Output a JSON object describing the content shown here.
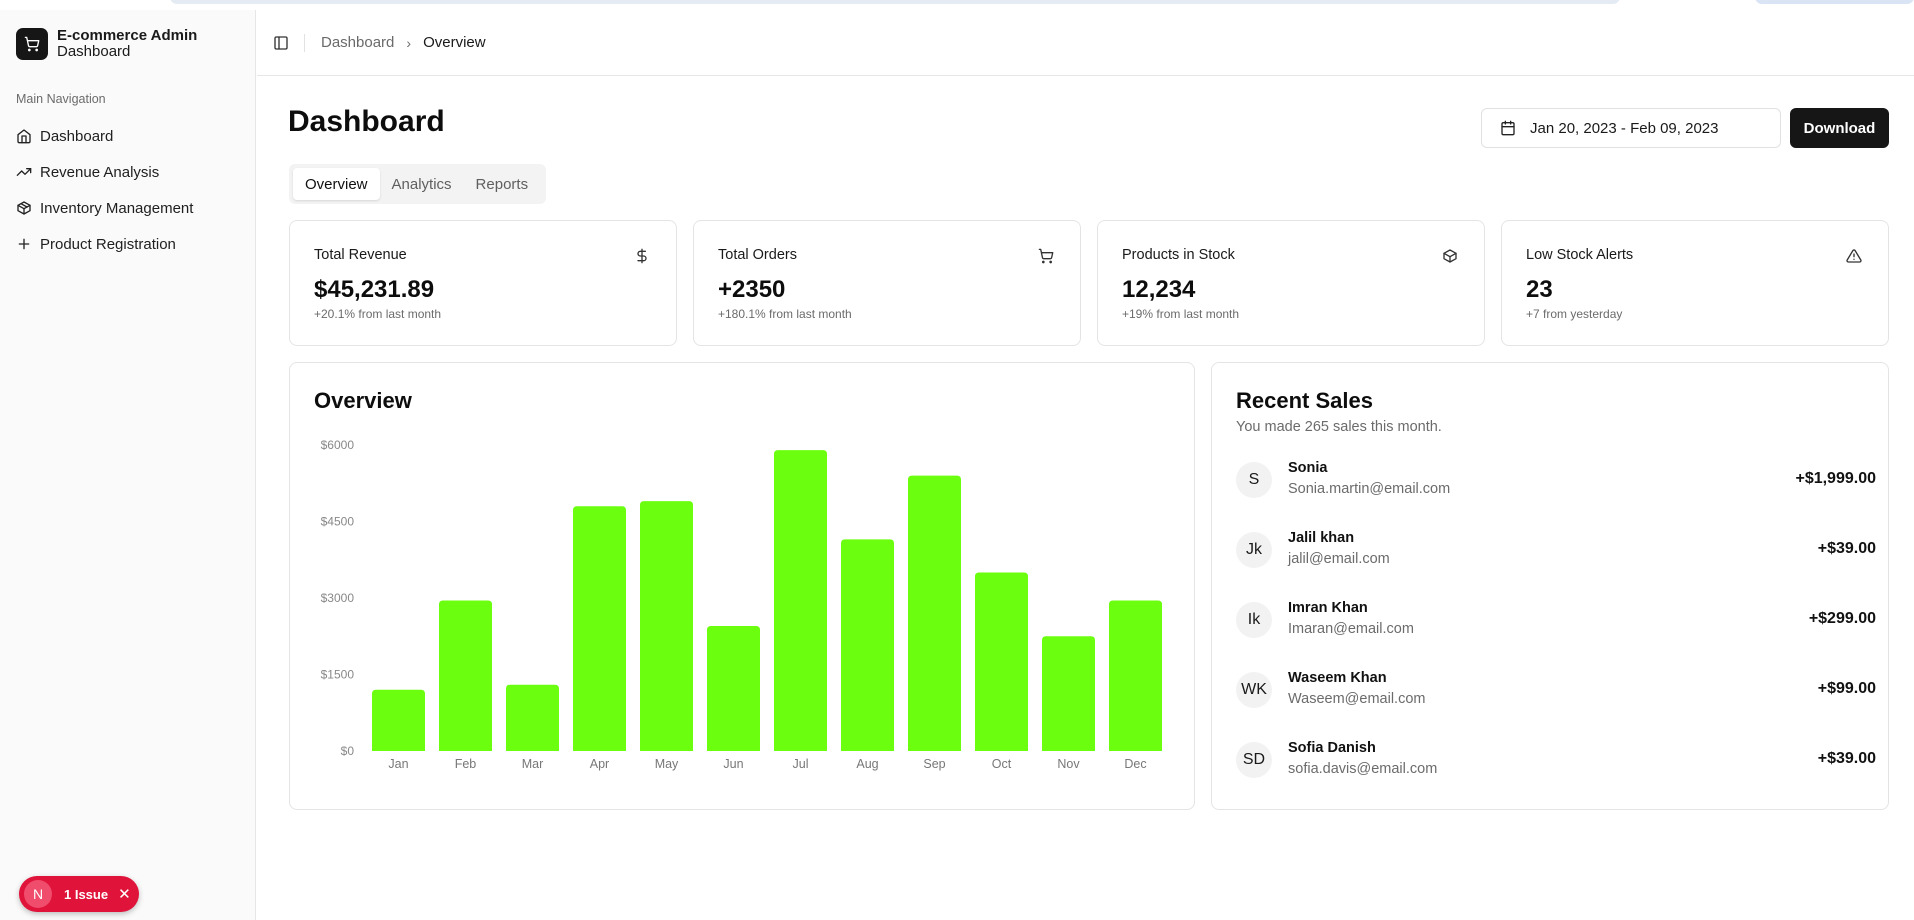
{
  "brand": {
    "title": "E-commerce Admin",
    "subtitle": "Dashboard",
    "icon": "cart-icon"
  },
  "sidebar": {
    "group_label": "Main Navigation",
    "items": [
      {
        "label": "Dashboard",
        "icon": "home-icon"
      },
      {
        "label": "Revenue Analysis",
        "icon": "trending-up-icon"
      },
      {
        "label": "Inventory Management",
        "icon": "package-icon"
      },
      {
        "label": "Product Registration",
        "icon": "plus-icon"
      }
    ]
  },
  "issues": {
    "letter": "N",
    "label": "1 Issue",
    "close": "✕",
    "color": "#e0133b"
  },
  "breadcrumb": {
    "parent": "Dashboard",
    "current": "Overview"
  },
  "page": {
    "title": "Dashboard",
    "date_range": "Jan 20, 2023 - Feb 09, 2023",
    "download_label": "Download",
    "tabs": [
      {
        "label": "Overview",
        "active": true
      },
      {
        "label": "Analytics",
        "active": false
      },
      {
        "label": "Reports",
        "active": false
      }
    ]
  },
  "stats": [
    {
      "title": "Total Revenue",
      "value": "$45,231.89",
      "note": "+20.1% from last month",
      "icon": "dollar-icon"
    },
    {
      "title": "Total Orders",
      "value": "+2350",
      "note": "+180.1% from last month",
      "icon": "cart-icon"
    },
    {
      "title": "Products in Stock",
      "value": "12,234",
      "note": "+19% from last month",
      "icon": "package-icon"
    },
    {
      "title": "Low Stock Alerts",
      "value": "23",
      "note": "+7 from yesterday",
      "icon": "alert-triangle-icon"
    }
  ],
  "overview": {
    "title": "Overview"
  },
  "chart_data": {
    "type": "bar",
    "title": "Overview",
    "categories": [
      "Jan",
      "Feb",
      "Mar",
      "Apr",
      "May",
      "Jun",
      "Jul",
      "Aug",
      "Sep",
      "Oct",
      "Nov",
      "Dec"
    ],
    "values": [
      1200,
      2950,
      1300,
      4800,
      4900,
      2450,
      5900,
      4150,
      5400,
      3500,
      2250,
      2950
    ],
    "yticks": [
      "$0",
      "$1500",
      "$3000",
      "$4500",
      "$6000"
    ],
    "ylim": [
      0,
      6000
    ],
    "bar_color": "#6bff0f",
    "grid": false,
    "xlabel": "",
    "ylabel": ""
  },
  "recent_sales": {
    "title": "Recent Sales",
    "subtitle": "You made 265 sales this month.",
    "items": [
      {
        "initials": "S",
        "name": "Sonia",
        "email": "Sonia.martin@email.com",
        "amount": "+$1,999.00"
      },
      {
        "initials": "Jk",
        "name": "Jalil khan",
        "email": "jalil@email.com",
        "amount": "+$39.00"
      },
      {
        "initials": "Ik",
        "name": "Imran Khan",
        "email": "Imaran@email.com",
        "amount": "+$299.00"
      },
      {
        "initials": "WK",
        "name": "Waseem Khan",
        "email": "Waseem@email.com",
        "amount": "+$99.00"
      },
      {
        "initials": "SD",
        "name": "Sofia Danish",
        "email": "sofia.davis@email.com",
        "amount": "+$39.00"
      }
    ]
  }
}
